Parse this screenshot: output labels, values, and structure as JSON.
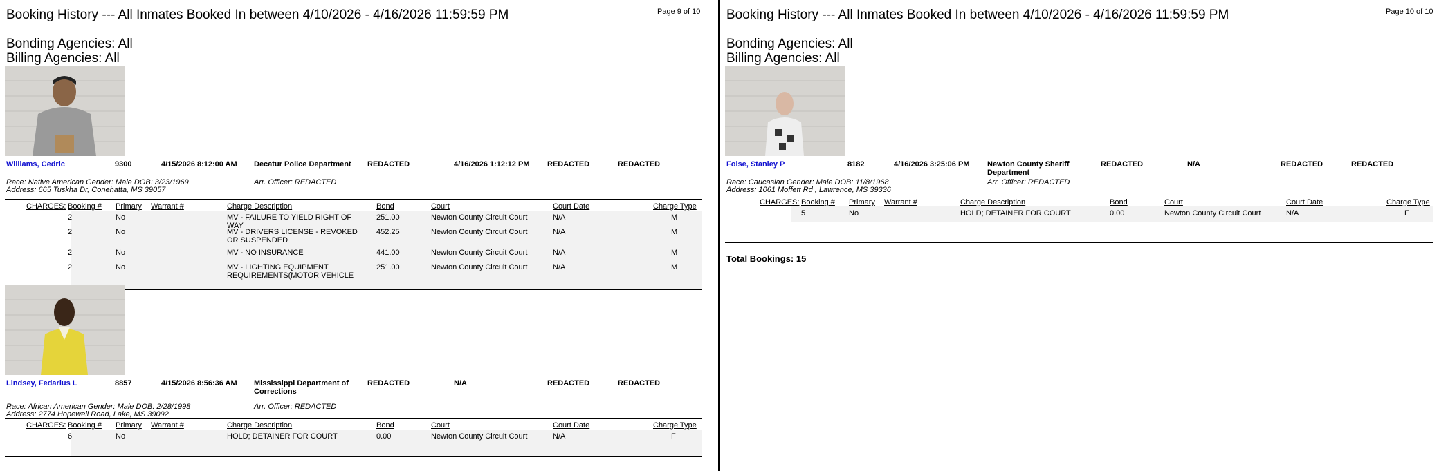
{
  "pages": [
    {
      "title": "Booking History    ---   All Inmates Booked In between 4/10/2026 - 4/16/2026 11:59:59 PM",
      "page_label": "Page 9 of 10",
      "bonding": "Bonding Agencies: All",
      "billing": "Billing Agencies: All",
      "charge_headers": {
        "charges": "CHARGES:",
        "booking": "Booking #",
        "primary": "Primary",
        "warrant": "Warrant #",
        "desc": "Charge Description",
        "bond": "Bond",
        "court": "Court",
        "court_date": "Court Date",
        "type": "Charge Type"
      },
      "records": [
        {
          "name": "Williams, Cedric",
          "id": "9300",
          "booked": "4/15/2026 8:12:00 AM",
          "agency": "Decatur Police Department",
          "f1": "REDACTED",
          "released": "4/16/2026 1:12:12 PM",
          "f2": "REDACTED",
          "f3": "REDACTED",
          "race_line": "Race: Native American    Gender: Male    DOB:  3/23/1969",
          "address": "Address: 665 Tuskha Dr, Conehatta, MS 39057",
          "officer": "Arr. Officer: REDACTED",
          "charges": [
            {
              "booking": "2",
              "primary": "No",
              "desc": "MV - FAILURE TO YIELD RIGHT OF WAY",
              "bond": "251.00",
              "court": "Newton County Circuit Court",
              "date": "N/A",
              "type": "M"
            },
            {
              "booking": "2",
              "primary": "No",
              "desc": "MV - DRIVERS LICENSE - REVOKED OR SUSPENDED",
              "bond": "452.25",
              "court": "Newton County Circuit Court",
              "date": "N/A",
              "type": "M"
            },
            {
              "booking": "2",
              "primary": "No",
              "desc": "MV - NO INSURANCE",
              "bond": "441.00",
              "court": "Newton County Circuit Court",
              "date": "N/A",
              "type": "M"
            },
            {
              "booking": "2",
              "primary": "No",
              "desc": "MV - LIGHTING EQUIPMENT REQUIREMENTS(MOTOR VEHICLE",
              "bond": "251.00",
              "court": "Newton County Circuit Court",
              "date": "N/A",
              "type": "M"
            }
          ]
        },
        {
          "name": "Lindsey, Fedarius L",
          "id": "8857",
          "booked": "4/15/2026 8:56:36 AM",
          "agency": "Mississippi Department of Corrections",
          "f1": "REDACTED",
          "released": "N/A",
          "f2": "REDACTED",
          "f3": "REDACTED",
          "race_line": "Race: African American    Gender: Male    DOB:  2/28/1998",
          "address": "Address: 2774 Hopewell Road, Lake, MS 39092",
          "officer": "Arr. Officer: REDACTED",
          "charges": [
            {
              "booking": "6",
              "primary": "No",
              "desc": "HOLD; DETAINER FOR COURT",
              "bond": "0.00",
              "court": "Newton County Circuit Court",
              "date": "N/A",
              "type": "F"
            }
          ]
        }
      ]
    },
    {
      "title": "Booking History    ---   All Inmates Booked In between 4/10/2026 - 4/16/2026 11:59:59 PM",
      "page_label": "Page 10 of 10",
      "bonding": "Bonding Agencies: All",
      "billing": "Billing Agencies: All",
      "charge_headers": {
        "charges": "CHARGES:",
        "booking": "Booking #",
        "primary": "Primary",
        "warrant": "Warrant #",
        "desc": "Charge Description",
        "bond": "Bond",
        "court": "Court",
        "court_date": "Court Date",
        "type": "Charge Type"
      },
      "records": [
        {
          "name": "Folse, Stanley P",
          "id": "8182",
          "booked": "4/16/2026 3:25:06 PM",
          "agency": "Newton County Sheriff Department",
          "f1": "REDACTED",
          "released": "N/A",
          "f2": "REDACTED",
          "f3": "REDACTED",
          "race_line": "Race: Caucasian    Gender: Male    DOB:  11/8/1968",
          "address": "Address: 1061 Moffett Rd , Lawrence, MS 39336",
          "officer": "Arr. Officer: REDACTED",
          "charges": [
            {
              "booking": "5",
              "primary": "No",
              "desc": "HOLD; DETAINER FOR COURT",
              "bond": "0.00",
              "court": "Newton County Circuit Court",
              "date": "N/A",
              "type": "F"
            }
          ]
        }
      ],
      "total": "Total Bookings: 15"
    }
  ]
}
